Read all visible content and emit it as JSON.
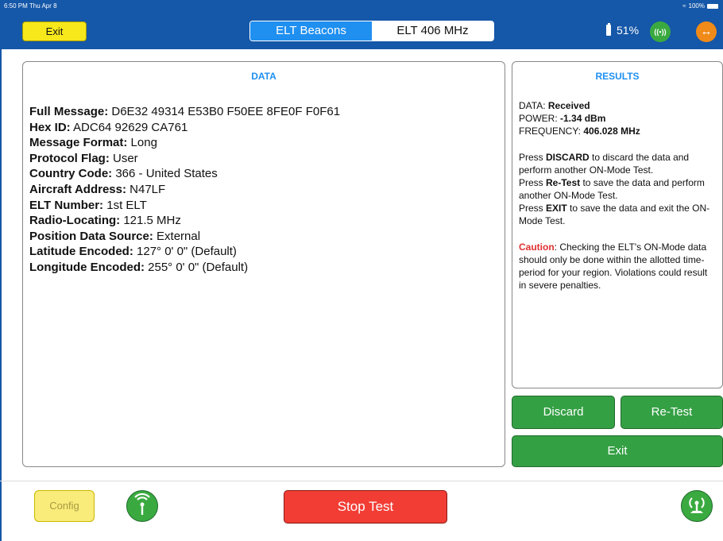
{
  "status_bar": {
    "time_date": "6:50 PM  Thu Apr 8",
    "battery_percent": "100%"
  },
  "header": {
    "exit_label": "Exit",
    "tabs": [
      {
        "label": "ELT Beacons",
        "active": true
      },
      {
        "label": "ELT 406 MHz",
        "active": false
      }
    ],
    "battery_label": "51%",
    "signal_glyph": "((•))"
  },
  "data_panel": {
    "title": "DATA",
    "items": [
      {
        "key": "Full Message:",
        "value": " D6E32 49314 E53B0 F50EE 8FE0F F0F61"
      },
      {
        "key": "Hex ID:",
        "value": " ADC64 92629 CA761"
      },
      {
        "key": "Message Format:",
        "value": " Long"
      },
      {
        "key": "Protocol Flag:",
        "value": " User"
      },
      {
        "key": "Country Code:",
        "value": " 366 - United States"
      },
      {
        "key": "Aircraft Address:",
        "value": " N47LF"
      },
      {
        "key": "ELT Number:",
        "value": " 1st ELT"
      },
      {
        "key": "Radio-Locating:",
        "value": " 121.5 MHz"
      },
      {
        "key": "Position Data Source:",
        "value": " External"
      },
      {
        "key": "Latitude Encoded:",
        "value": " 127° 0' 0\" (Default)"
      },
      {
        "key": "Longitude Encoded:",
        "value": " 255° 0' 0\" (Default)"
      }
    ]
  },
  "results_panel": {
    "title": "RESULTS",
    "data_label": "DATA: ",
    "data_value": "Received",
    "power_label": "POWER: ",
    "power_value": "-1.34 dBm",
    "frequency_label": "FREQUENCY: ",
    "frequency_value": "406.028 MHz",
    "press1": "Press ",
    "discard_word": "DISCARD",
    "discard_rest": " to discard the data and perform another ON-Mode Test.",
    "press2": "Press ",
    "retest_word": "Re-Test",
    "retest_rest": " to save the data and perform another ON-Mode Test.",
    "press3": "Press ",
    "exit_word": "EXIT",
    "exit_rest": " to save the data and exit the ON-Mode Test.",
    "caution_label": "Caution",
    "caution_text": ": Checking the ELT's ON-Mode data should only be done within the allotted time-period for your region. Violations could result in severe penalties."
  },
  "actions": {
    "discard_label": "Discard",
    "retest_label": "Re-Test",
    "exit_label": "Exit"
  },
  "footer": {
    "config_label": "Config",
    "stop_label": "Stop Test"
  },
  "colors": {
    "header_bg": "#1557a8",
    "accent_blue": "#1f8ff0",
    "green": "#34a044",
    "yellow": "#f7e81c",
    "red": "#f23d35",
    "orange": "#f08a18"
  }
}
